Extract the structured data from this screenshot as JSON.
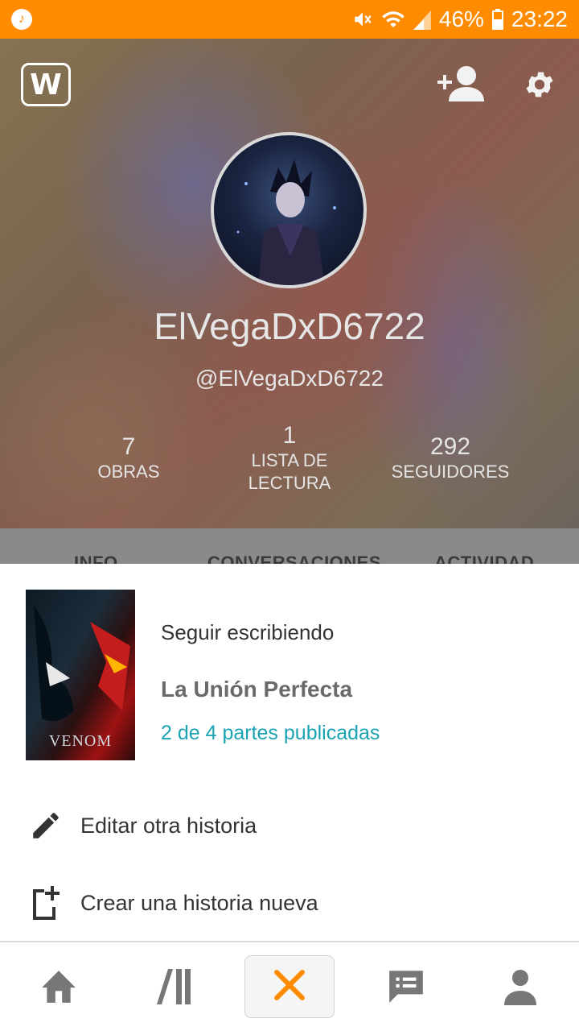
{
  "status_bar": {
    "battery": "46%",
    "time": "23:22"
  },
  "profile": {
    "display_name": "ElVegaDxD6722",
    "handle": "@ElVegaDxD6722",
    "stats": [
      {
        "value": "7",
        "label": "OBRAS"
      },
      {
        "value": "1",
        "label": "LISTA DE LECTURA"
      },
      {
        "value": "292",
        "label": "SEGUIDORES"
      }
    ]
  },
  "tabs": [
    "INFO",
    "CONVERSACIONES",
    "ACTIVIDAD"
  ],
  "sheet": {
    "continue_label": "Seguir escribiendo",
    "story_title": "La Unión Perfecta",
    "parts": "2 de 4 partes publicadas",
    "cover_text": "VENOM",
    "edit_label": "Editar otra historia",
    "create_label": "Crear una historia nueva"
  },
  "icons": {
    "status": [
      "music-icon",
      "mute-icon",
      "wifi-icon",
      "signal-icon",
      "battery-icon"
    ],
    "header": [
      "wattpad-logo-icon",
      "add-friend-icon",
      "settings-icon"
    ],
    "nav": [
      "home-icon",
      "library-icon",
      "close-icon",
      "messages-icon",
      "profile-icon"
    ]
  },
  "colors": {
    "accent": "#ff8c00",
    "link": "#1aa3b3",
    "close": "#ff8c00"
  }
}
